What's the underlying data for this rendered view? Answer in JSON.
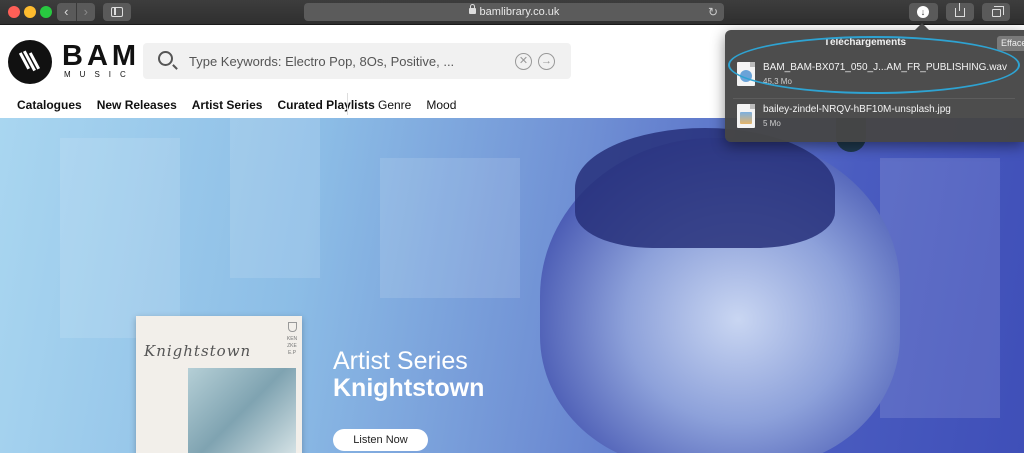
{
  "browser": {
    "url": "bamlibrary.co.uk",
    "back_glyph": "‹",
    "forward_glyph": "›",
    "reload_glyph": "↻",
    "download_glyph": "↓"
  },
  "site": {
    "logo_word": "BAM",
    "logo_sub": "MUSIC",
    "search": {
      "placeholder": "Type Keywords: Electro Pop, 8Os, Positive, ...",
      "clear_glyph": "✕",
      "go_glyph": "→"
    },
    "menu": [
      "Catalogues",
      "New Releases",
      "Artist Series",
      "Curated Playlists"
    ],
    "menu_secondary": [
      "Genre",
      "Mood"
    ]
  },
  "hero": {
    "title": "Artist Series",
    "subtitle": "Knightstown",
    "button_label": "Listen Now",
    "album_script": "Knightstown",
    "album_side_text": "KEN ZKE E.P"
  },
  "downloads": {
    "title": "Téléchargements",
    "clear_label": "Effacer",
    "items": [
      {
        "name": "BAM_BAM-BX071_050_J...AM_FR_PUBLISHING.wav",
        "size": "45,3 Mo",
        "icon": "audio-file-icon"
      },
      {
        "name": "bailey-zindel-NRQV-hBF10M-unsplash.jpg",
        "size": "5 Mo",
        "icon": "image-file-icon"
      }
    ]
  },
  "colors": {
    "highlight_ring": "#2ea3d2",
    "hero_gradient_start": "#a9d6f0",
    "hero_gradient_end": "#3f4fb8"
  }
}
